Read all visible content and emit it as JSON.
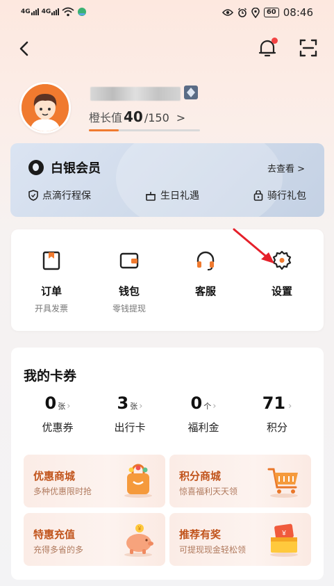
{
  "status_bar": {
    "signal_1": "4G",
    "signal_2": "4G",
    "battery": "60",
    "time": "08:46",
    "icons": [
      "eye-icon",
      "alarm-icon",
      "location-icon",
      "wifi-icon"
    ]
  },
  "header": {
    "icons": [
      "back-icon",
      "bell-icon",
      "scan-icon"
    ],
    "has_notification": true
  },
  "profile": {
    "growth_label": "橙长值",
    "growth_value": "40",
    "growth_max": "/150",
    "growth_chevron": ">",
    "growth_progress": 0.27
  },
  "membership": {
    "title": "白银会员",
    "link": "去查看 >",
    "benefits": [
      {
        "label": "点滴行程保",
        "icon": "shield-icon"
      },
      {
        "label": "生日礼遇",
        "icon": "cake-icon"
      },
      {
        "label": "骑行礼包",
        "icon": "gift-icon"
      }
    ]
  },
  "services": [
    {
      "label": "订单",
      "sub": "开具发票",
      "icon": "order-icon"
    },
    {
      "label": "钱包",
      "sub": "零钱提现",
      "icon": "wallet-icon"
    },
    {
      "label": "客服",
      "sub": "",
      "icon": "headset-icon"
    },
    {
      "label": "设置",
      "sub": "",
      "icon": "settings-icon"
    }
  ],
  "coupons": {
    "title": "我的卡券",
    "stats": [
      {
        "value": "0",
        "unit": "张",
        "label": "优惠券"
      },
      {
        "value": "3",
        "unit": "张",
        "label": "出行卡"
      },
      {
        "value": "0",
        "unit": "个",
        "label": "福利金"
      },
      {
        "value": "71",
        "unit": "",
        "label": "积分"
      }
    ],
    "promos": [
      {
        "title": "优惠商城",
        "sub": "多种优惠限时抢",
        "icon": "shopping-bag-icon"
      },
      {
        "title": "积分商城",
        "sub": "惊喜福利天天领",
        "icon": "shopping-cart-icon"
      },
      {
        "title": "特惠充值",
        "sub": "充得多省的多",
        "icon": "piggy-bank-icon"
      },
      {
        "title": "推荐有奖",
        "sub": "可提现现金轻松领",
        "icon": "gift-box-icon"
      }
    ]
  },
  "colors": {
    "accent": "#f07a2f",
    "promo_title": "#c1541c",
    "arrow": "#e5202a",
    "notification_dot": "#f24343"
  }
}
